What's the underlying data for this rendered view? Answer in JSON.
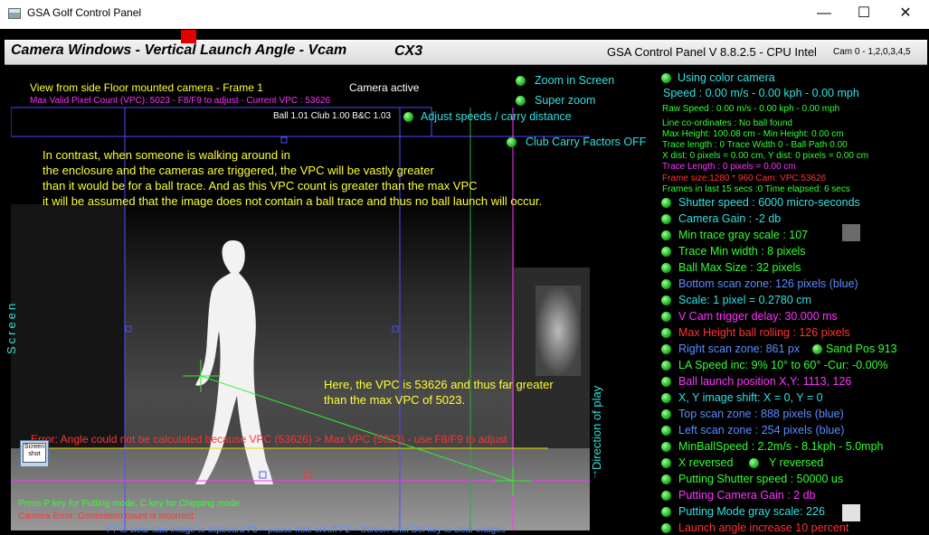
{
  "window": {
    "title": "GSA Golf Control Panel",
    "minimize": "—",
    "maximize": "☐",
    "close": "✕"
  },
  "header": {
    "panel_title": "Camera Windows - Vertical Launch Angle - Vcam",
    "cx_label": "CX3",
    "version": "GSA Control Panel V 8.8.2.5 - CPU Intel",
    "cam_list": "Cam 0 - 1,2,0,3,4,5"
  },
  "left": {
    "view_title": "View from side Floor mounted camera -  Frame 1",
    "camera_active": "Camera active",
    "max_vpc": "Max Valid Pixel Count (VPC): 5023  - F8/F9 to adjust - Current VPC : 53626",
    "ball_club": "Ball 1.01 Club 1.00 B&C 1.03",
    "annotation1": [
      "In contrast, when someone is walking around in",
      "the enclosure and the cameras are triggered, the VPC will be vastly greater",
      "than it would be for a ball trace. And as this VPC count is greater than the max VPC",
      "it will be assumed that the image does not contain a ball trace and thus no ball launch will occur."
    ],
    "annotation2": [
      "Here, the VPC is 53626 and thus far greater",
      "than the max VPC of 5023."
    ],
    "error": "Error: Angle could not be calculated because VPC (53626) > Max VPC (5023) - use F8/F9 to adjust",
    "screen_vertical": "Screen",
    "direction_vertical": "Direction of play",
    "screenshot_btn": [
      "Screen",
      "shot"
    ],
    "press_p": "Press P key for Putting mode, C key for Chipping mode",
    "cam_error": "Camera Error: Generation count is incorrect.",
    "bottom_help": "F7 to clear saw image to clipboard  F3 = pause hole on/off  F2 = Screen shot  Del key to clear images"
  },
  "options": {
    "zoom_in_screen": "Zoom in Screen",
    "super_zoom": "Super zoom",
    "adjust_speeds": "Adjust speeds / carry distance",
    "club_carry": "Club Carry Factors OFF"
  },
  "right": {
    "using_color": "Using color camera",
    "speed": "Speed : 0.00 m/s - 0.00 kph - 0.00 mph",
    "raw_speed": "Raw Speed : 0.00 m/s - 0.00 kph - 0.00 mph",
    "line_coords": "Line co-ordinates : No ball found",
    "max_height": "Max Height: 100.08 cm - Min Height: 0.00 cm",
    "trace_length": "Trace length : 0 Trace Width 0 - Ball Path 0.00",
    "x_dist": "X dist: 0 pixels = 0.00 cm, Y dist: 0 pixels = 0.00 cm",
    "trace_len_px": "Trace Length : 0 pixels = 0.00 cm",
    "frame_size": "Frame size:1280 * 960 Cam:  VPC:53626",
    "frames_last": "Frames in last 15 secs :0 Time elapsed:   6 secs",
    "shutter_speed": "Shutter speed : 6000 micro-seconds",
    "camera_gain": "Camera Gain : -2 db",
    "min_trace_gray": "Min trace gray scale : 107",
    "trace_min_width": "Trace Min width : 8 pixels",
    "ball_max_size": "Ball Max Size : 32 pixels",
    "bottom_scan": "Bottom scan zone: 126 pixels (blue)",
    "scale": "Scale: 1 pixel = 0.2780 cm",
    "vcam_trigger": "V Cam trigger delay: 30.000 ms",
    "max_height_rolling": "Max Height ball rolling : 126 pixels",
    "right_scan": "Right scan zone: 861 px",
    "sand_pos": "Sand Pos 913",
    "la_speed": "LA Speed inc: 9% 10° to 60° -Cur: -0.00%",
    "ball_launch_pos": "Ball launch position X,Y: 1113, 126",
    "xy_shift": "X, Y image shift: X = 0, Y = 0",
    "top_scan": "Top scan zone : 888 pixels (blue)",
    "left_scan": "Left scan zone : 254 pixels (blue)",
    "min_ball_speed": "MinBallSpeed : 2.2m/s - 8.1kph - 5.0mph",
    "x_reversed": "X reversed",
    "y_reversed": "Y reversed",
    "putting_shutter": "Putting Shutter speed : 50000 us",
    "putting_gain": "Putting Camera Gain : 2 db",
    "putting_gray": "Putting Mode gray scale: 226",
    "launch_angle_inc": "Launch angle increase 10 percent"
  },
  "colors": {
    "yellow": "#ffff33",
    "magenta": "#ff33ff",
    "cyan": "#33e0e0",
    "green": "#33ff33",
    "red": "#ff3333",
    "blue": "#5b8cff",
    "header_red": "#e00000"
  }
}
